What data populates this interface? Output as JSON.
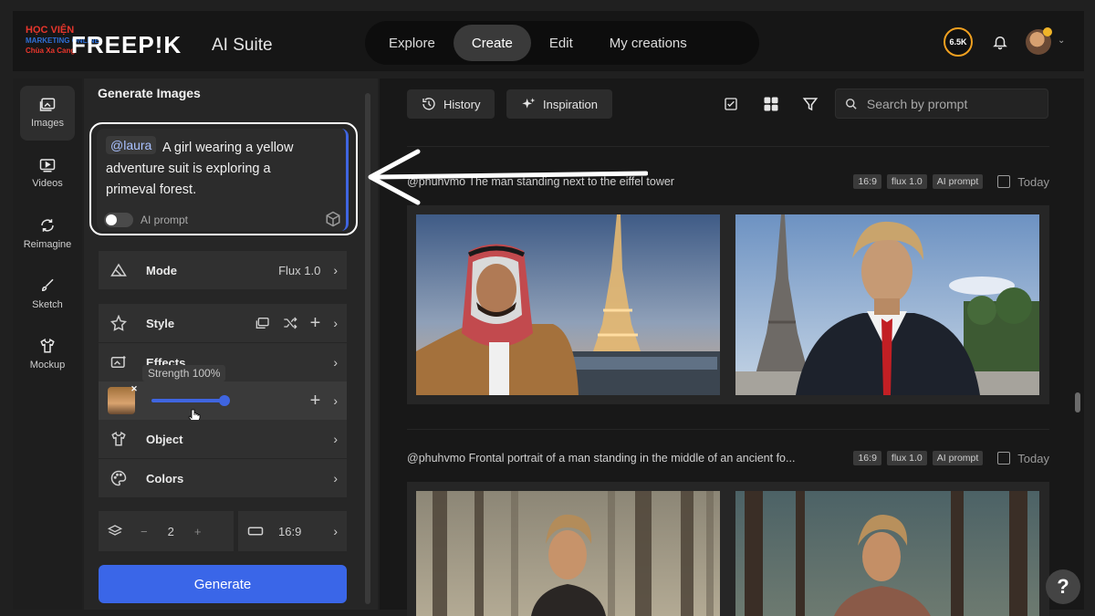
{
  "brand": {
    "watermark_line1": "HỌC VIỆN",
    "watermark_line2": "MARKETING ONLINE",
    "watermark_line3": "Chùa Xa Cang",
    "logo": "FREEP!K",
    "suite": "AI Suite"
  },
  "nav": {
    "items": [
      {
        "label": "Explore",
        "active": false
      },
      {
        "label": "Create",
        "active": true
      },
      {
        "label": "Edit",
        "active": false
      },
      {
        "label": "My creations",
        "active": false
      }
    ]
  },
  "header": {
    "credits": "6.5K",
    "icons": [
      "bell-icon",
      "avatar",
      "chevron-down-icon"
    ]
  },
  "rail": {
    "items": [
      {
        "label": "Images",
        "icon": "images-icon",
        "active": true
      },
      {
        "label": "Videos",
        "icon": "video-icon",
        "active": false
      },
      {
        "label": "Reimagine",
        "icon": "refresh-icon",
        "active": false
      },
      {
        "label": "Sketch",
        "icon": "brush-icon",
        "active": false
      },
      {
        "label": "Mockup",
        "icon": "shirt-icon",
        "active": false
      }
    ]
  },
  "generator": {
    "title": "Generate Images",
    "prompt_mention": "@laura",
    "prompt_text": "A girl wearing a yellow adventure suit is exploring a primeval forest.",
    "ai_prompt_label": "AI prompt",
    "ai_prompt_enabled": false,
    "mode_label": "Mode",
    "mode_value": "Flux 1.0",
    "style_label": "Style",
    "effects_label": "Effects",
    "strength_tooltip": "Strength 100%",
    "strength_value": 1.0,
    "object_label": "Object",
    "colors_label": "Colors",
    "count_minus": "−",
    "count_value": "2",
    "count_plus": "+",
    "aspect_value": "16:9",
    "generate_label": "Generate"
  },
  "toolbar": {
    "history_label": "History",
    "inspiration_label": "Inspiration",
    "search_placeholder": "Search by prompt"
  },
  "groups": [
    {
      "prompt": "@phuhvmo The man standing next to the eiffel tower",
      "tags": [
        "16:9",
        "flux 1.0",
        "AI prompt"
      ],
      "date": "Today"
    },
    {
      "prompt": "@phuhvmo Frontal portrait of a man standing in the middle of an ancient fo...",
      "tags": [
        "16:9",
        "flux 1.0",
        "AI prompt"
      ],
      "date": "Today"
    }
  ],
  "help_label": "?",
  "colors": {
    "accent": "#3a66e8",
    "credits_ring": "#f0a020"
  }
}
